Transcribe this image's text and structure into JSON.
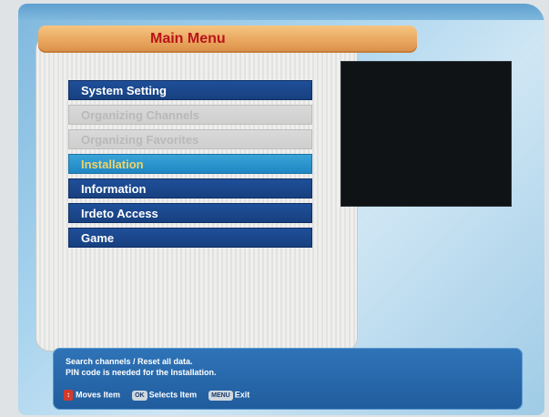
{
  "header": {
    "title": "Main Menu"
  },
  "menu": {
    "items": [
      {
        "label": "System Setting",
        "state": "normal"
      },
      {
        "label": "Organizing Channels",
        "state": "disabled"
      },
      {
        "label": "Organizing Favorites",
        "state": "disabled"
      },
      {
        "label": "Installation",
        "state": "selected"
      },
      {
        "label": "Information",
        "state": "normal"
      },
      {
        "label": "Irdeto Access",
        "state": "normal"
      },
      {
        "label": "Game",
        "state": "normal"
      }
    ]
  },
  "help": {
    "line1": "Search channels / Reset all data.",
    "line2": "PIN code is needed for the Installation.",
    "hints": {
      "move_label": "Moves Item",
      "ok_key": "OK",
      "select_label": "Selects Item",
      "menu_key": "MENU",
      "exit_label": "Exit"
    }
  },
  "colors": {
    "title_text": "#b8141a",
    "menu_item_bg": "#1f4f9a",
    "menu_selected_bg": "#2b95cd",
    "menu_selected_text": "#f0d56a",
    "menu_disabled_bg": "#d4d4d4"
  },
  "icons": {
    "nav_arrows": "up-down-arrows-icon"
  }
}
